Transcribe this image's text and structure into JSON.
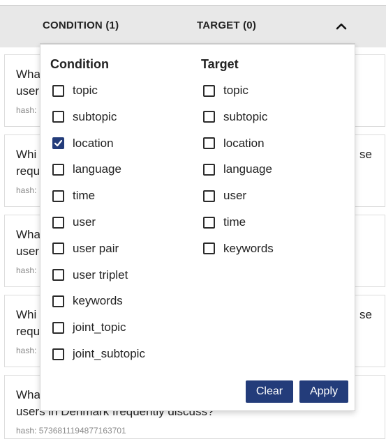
{
  "header": {
    "tabs": [
      {
        "label": "CONDITION (1)"
      },
      {
        "label": "TARGET (0)"
      }
    ],
    "collapse_icon": "chevron-up-icon"
  },
  "cards": [
    {
      "q": "Wha",
      "q2": "user",
      "hash": "hash:"
    },
    {
      "q": "Whi",
      "q_right": "se",
      "q2": "requ",
      "hash": "hash:"
    },
    {
      "q": "Wha",
      "q2": "user",
      "hash": "hash:"
    },
    {
      "q": "Whi",
      "q_right": "se",
      "q2": "requ",
      "hash": "hash:"
    },
    {
      "q": "Wha",
      "q2": "users in Denmark frequently discuss?",
      "hash": "hash: 5736811194877163701"
    }
  ],
  "dropdown": {
    "condition": {
      "title": "Condition",
      "options": [
        {
          "label": "topic",
          "checked": false
        },
        {
          "label": "subtopic",
          "checked": false
        },
        {
          "label": "location",
          "checked": true
        },
        {
          "label": "language",
          "checked": false
        },
        {
          "label": "time",
          "checked": false
        },
        {
          "label": "user",
          "checked": false
        },
        {
          "label": "user pair",
          "checked": false
        },
        {
          "label": "user triplet",
          "checked": false
        },
        {
          "label": "keywords",
          "checked": false
        },
        {
          "label": "joint_topic",
          "checked": false
        },
        {
          "label": "joint_subtopic",
          "checked": false
        }
      ]
    },
    "target": {
      "title": "Target",
      "options": [
        {
          "label": "topic",
          "checked": false
        },
        {
          "label": "subtopic",
          "checked": false
        },
        {
          "label": "location",
          "checked": false
        },
        {
          "label": "language",
          "checked": false
        },
        {
          "label": "user",
          "checked": false
        },
        {
          "label": "time",
          "checked": false
        },
        {
          "label": "keywords",
          "checked": false
        }
      ]
    },
    "clear_label": "Clear",
    "apply_label": "Apply"
  },
  "colors": {
    "accent": "#233c7a",
    "header_bg": "#e8e8e8"
  }
}
